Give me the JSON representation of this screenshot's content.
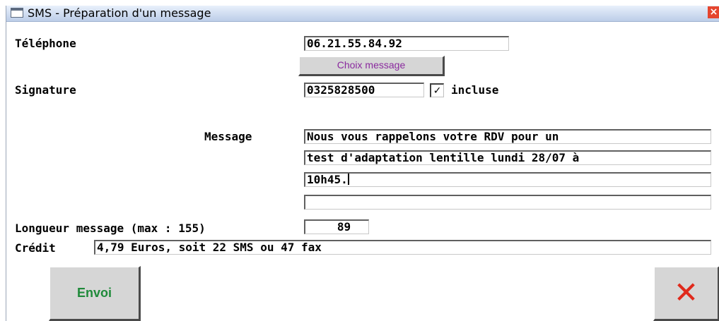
{
  "window": {
    "title": "SMS - Préparation d'un message",
    "close_icon": "close-icon"
  },
  "telephone": {
    "label": "Téléphone",
    "value": "06.21.55.84.92"
  },
  "choix_button": {
    "label": "Choix message"
  },
  "signature": {
    "label": "Signature",
    "value": "0325828500",
    "checked": true,
    "check_mark": "✓",
    "check_label": "incluse"
  },
  "message": {
    "label": "Message",
    "lines": [
      "Nous vous rappelons votre RDV pour un",
      "test d'adaptation lentille lundi 28/07 à",
      "10h45.",
      ""
    ]
  },
  "length": {
    "label": "Longueur message (max : 155)",
    "value": "89"
  },
  "credit": {
    "label": "Crédit",
    "value": "4,79 Euros, soit 22 SMS ou 47 fax"
  },
  "buttons": {
    "send_label": "Envoi",
    "cancel_glyph": "✕"
  },
  "colors": {
    "send_text": "#1f8a3a",
    "cancel_icon": "#e02a1c",
    "choix_text": "#8a2a9e",
    "titlebar": "#bccde8"
  }
}
